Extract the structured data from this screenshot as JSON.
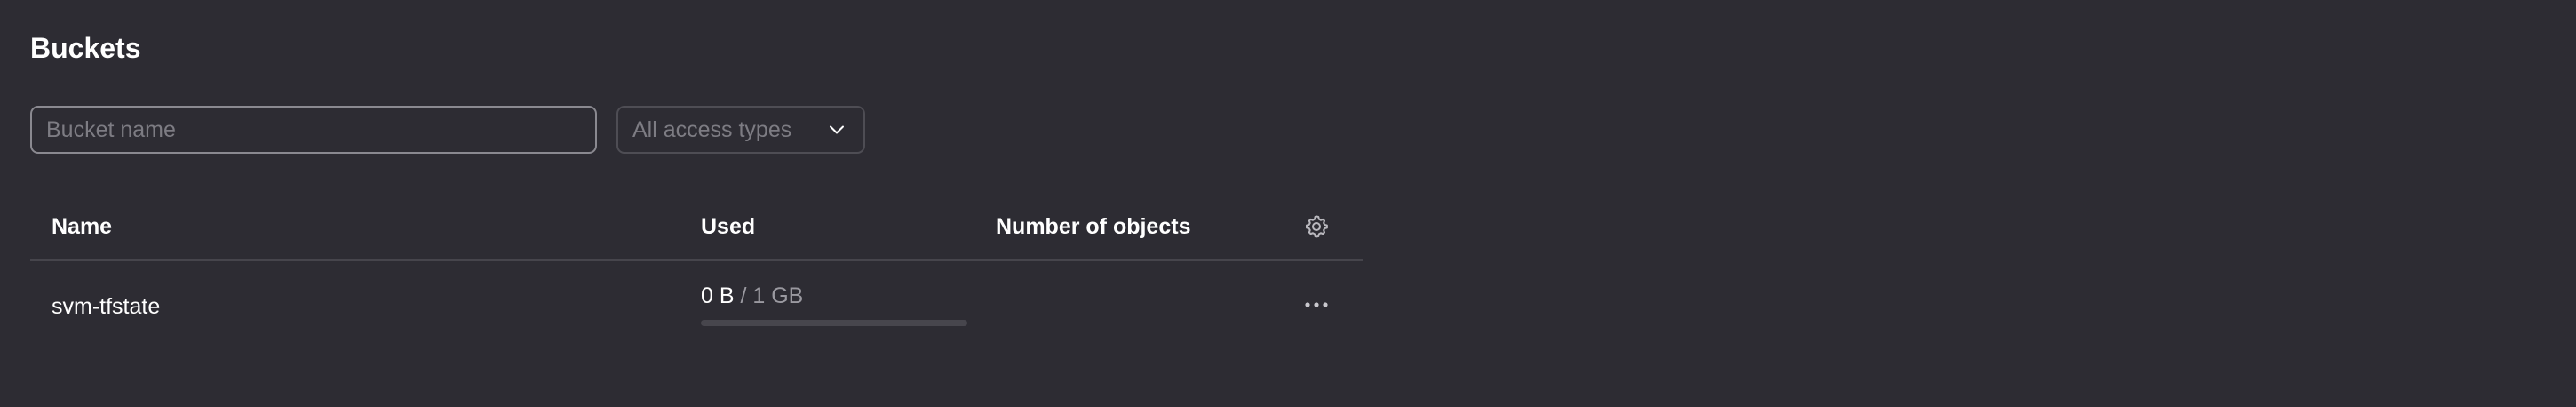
{
  "page": {
    "title": "Buckets"
  },
  "filters": {
    "search_placeholder": "Bucket name",
    "search_value": "",
    "access_type_selected": "All access types"
  },
  "table": {
    "columns": {
      "name": "Name",
      "used": "Used",
      "objects": "Number of objects"
    },
    "rows": [
      {
        "name": "svm-tfstate",
        "used_value": "0 B",
        "used_separator": " / ",
        "used_limit": "1 GB",
        "used_fraction": 0,
        "objects": ""
      }
    ]
  },
  "icons": {
    "select_chevron": "chevron-down-icon",
    "column_settings": "gear-icon",
    "row_actions": "more-horizontal-icon"
  },
  "colors": {
    "background": "#2d2c33",
    "text": "#ffffff",
    "muted_text": "#9a99a0",
    "divider": "#46454c"
  }
}
